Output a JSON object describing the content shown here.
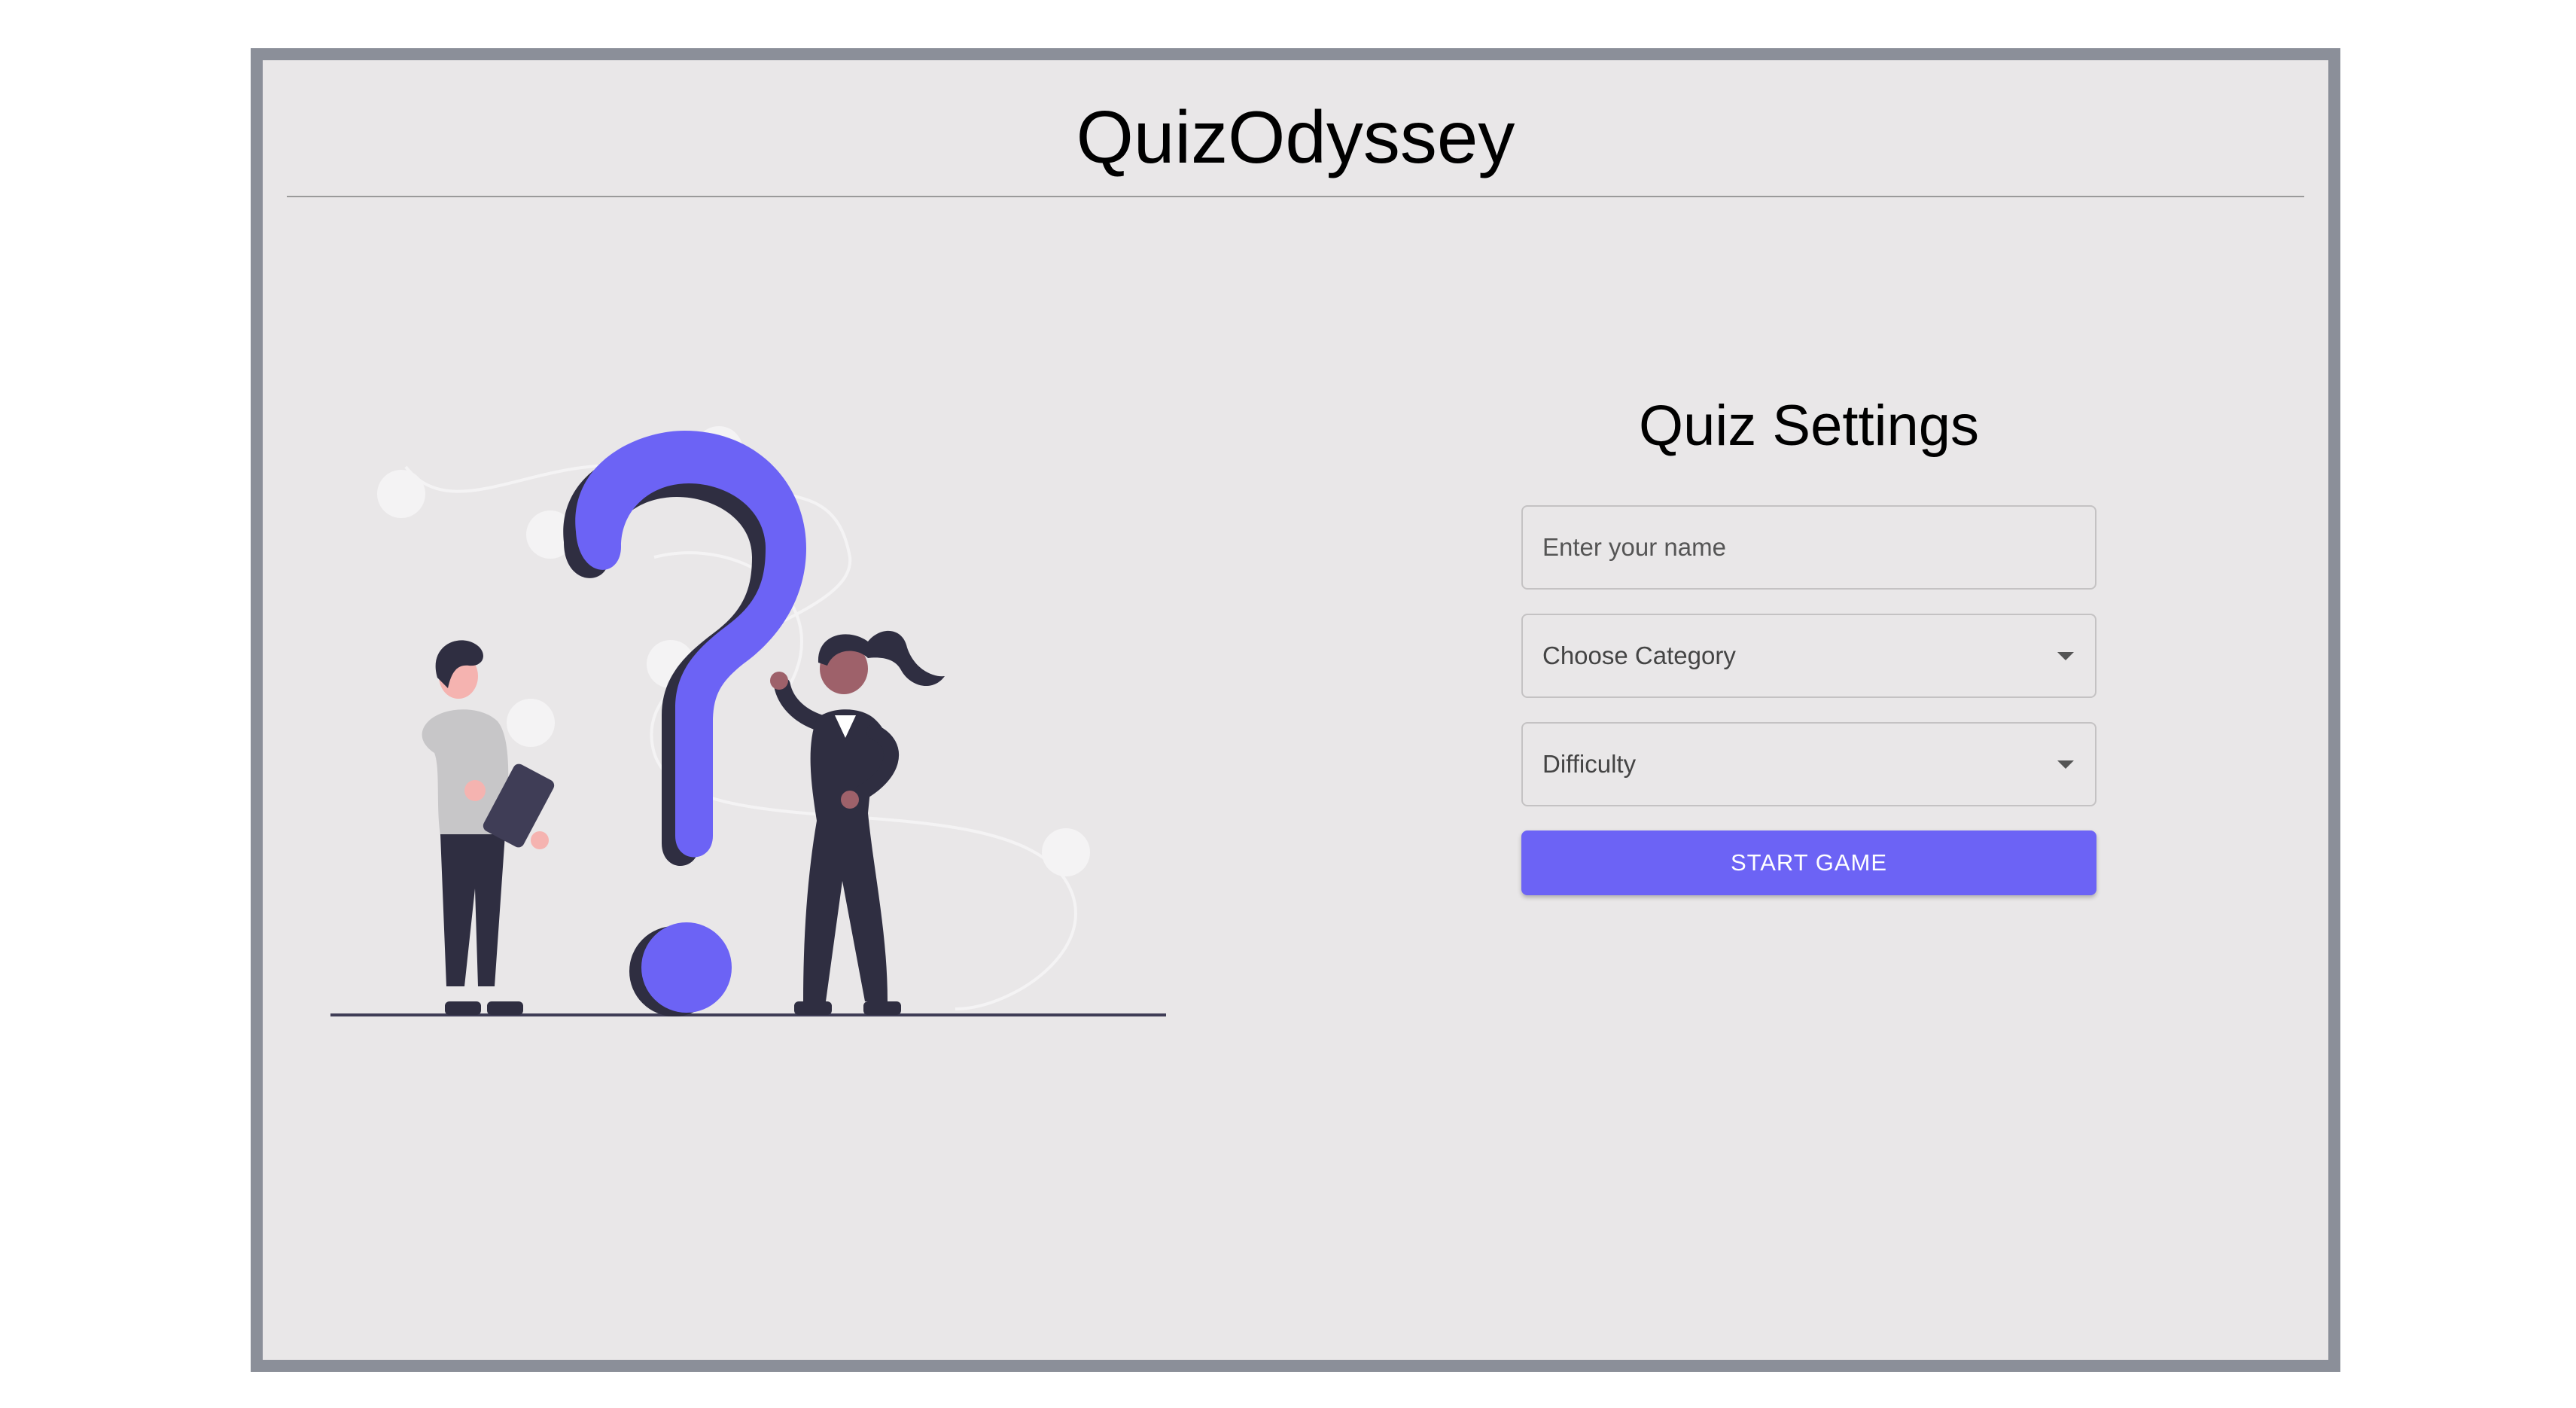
{
  "app": {
    "title": "QuizOdyssey"
  },
  "settings": {
    "title": "Quiz Settings",
    "name_field": {
      "value": "",
      "placeholder": "Enter your name"
    },
    "category_select": {
      "selected": "Choose Category",
      "icon": "chevron-down-icon"
    },
    "difficulty_select": {
      "selected": "Difficulty",
      "icon": "chevron-down-icon"
    },
    "start_button_label": "START GAME"
  },
  "illustration": {
    "name": "question-mark-illustration"
  },
  "colors": {
    "accent": "#6c63f5",
    "frame_border": "#8b8f99",
    "panel_background": "#e9e7e8",
    "dark_figure": "#2f2e41",
    "skin_light": "#f5b3b0",
    "skin_dark": "#9e616a",
    "shirt_gray": "#c7c6c8"
  }
}
